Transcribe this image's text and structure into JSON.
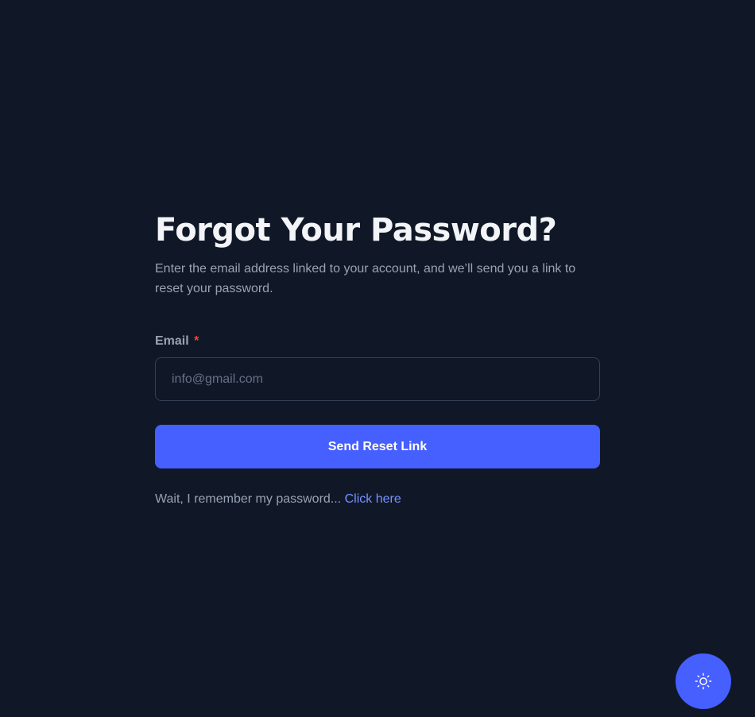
{
  "page": {
    "title": "Forgot Your Password?",
    "subtitle": "Enter the email address linked to your account, and we’ll send you a link to reset your password."
  },
  "form": {
    "email_label": "Email",
    "required_mark": "*",
    "email_value": "",
    "email_placeholder": "info@gmail.com",
    "submit_label": "Send Reset Link"
  },
  "footer": {
    "remember_text": "Wait, I remember my password... ",
    "link_text": "Click here"
  },
  "theme_toggle": {
    "icon": "sun-icon"
  },
  "colors": {
    "background": "#101828",
    "accent": "#465fff",
    "link": "#7592ff",
    "required": "#f04438"
  }
}
